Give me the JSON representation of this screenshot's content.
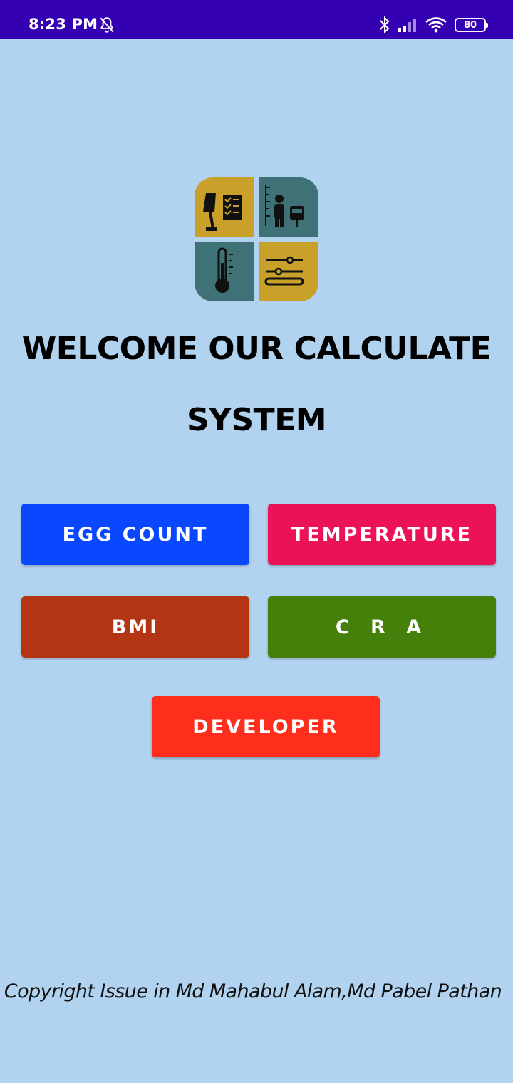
{
  "status_bar": {
    "time": "8:23 PM",
    "battery": "80",
    "icons": [
      "bell-off-icon",
      "bluetooth-icon",
      "signal-icon",
      "wifi-icon",
      "battery-icon"
    ]
  },
  "logo": {
    "name": "app-logo",
    "tiles": [
      "checklist-lamp-icon",
      "height-scale-person-icon",
      "thermometer-icon",
      "sliders-icon"
    ]
  },
  "main": {
    "title": "WELCOME OUR CALCULATE SYSTEM"
  },
  "buttons": {
    "egg_count": "EGG COUNT",
    "temperature": "TEMPERATURE",
    "bmi": "BMI",
    "cra": "C R A",
    "developer": "DEVELOPER"
  },
  "footer": {
    "copyright": "Copyright Issue in Md Mahabul Alam,Md Pabel Pathan"
  },
  "colors": {
    "background": "#b1d3ef",
    "status_bar": "#3400b2",
    "egg_count": "#0a48ff",
    "temperature": "#ec1258",
    "bmi": "#b33513",
    "cra": "#44800a",
    "developer": "#ff2e1c",
    "logo_gold": "#c9a12a",
    "logo_teal": "#3f7276"
  }
}
